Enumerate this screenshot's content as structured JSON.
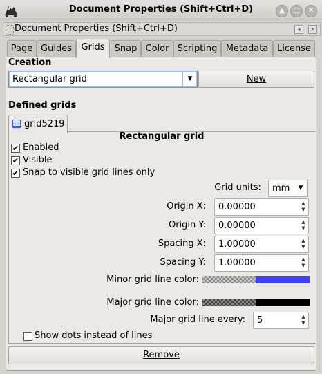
{
  "window": {
    "title": "Document Properties (Shift+Ctrl+D)"
  },
  "dock": {
    "title": "Document Properties (Shift+Ctrl+D)"
  },
  "tabs": [
    "Page",
    "Guides",
    "Grids",
    "Snap",
    "Color",
    "Scripting",
    "Metadata",
    "License"
  ],
  "creation": {
    "heading": "Creation",
    "grid_type": "Rectangular grid",
    "new_button": "New"
  },
  "defined": {
    "heading": "Defined grids",
    "grid_tab": "grid5219",
    "panel_title": "Rectangular grid"
  },
  "options": {
    "enabled": {
      "label": "Enabled",
      "checked": true
    },
    "visible": {
      "label": "Visible",
      "checked": true
    },
    "snap_visible": {
      "label": "Snap to visible grid lines only",
      "checked": true
    },
    "show_dots": {
      "label": "Show dots instead of lines",
      "checked": false
    }
  },
  "fields": {
    "grid_units_label": "Grid units:",
    "grid_units_value": "mm",
    "origin_x_label": "Origin X:",
    "origin_x": "0.00000",
    "origin_y_label": "Origin Y:",
    "origin_y": "0.00000",
    "spacing_x_label": "Spacing X:",
    "spacing_x": "1.00000",
    "spacing_y_label": "Spacing Y:",
    "spacing_y": "1.00000",
    "minor_color_label": "Minor grid line color:",
    "minor_color": "#3f3fff",
    "major_color_label": "Major grid line color:",
    "major_color": "#000000",
    "major_every_label": "Major grid line every:",
    "major_every": "5"
  },
  "remove_button": "Remove",
  "colors": {
    "accent_focus": "#6f95c3",
    "grid_icon": "#3a5ad8"
  }
}
